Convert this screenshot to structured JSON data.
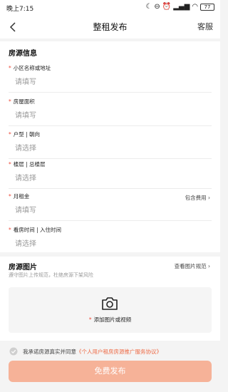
{
  "status": {
    "time": "晚上7:15",
    "battery": "77"
  },
  "header": {
    "title": "整租发布",
    "service_label": "客服"
  },
  "form": {
    "section_title": "房源信息",
    "fields": [
      {
        "label": "小区名称或地址",
        "placeholder": "请填写",
        "required": true,
        "extra": ""
      },
      {
        "label": "房屋面积",
        "placeholder": "请填写",
        "required": true,
        "extra": ""
      },
      {
        "label": "户型 | 朝向",
        "placeholder": "请选择",
        "required": true,
        "extra": ""
      },
      {
        "label": "楼层 | 总楼层",
        "placeholder": "请选择",
        "required": true,
        "extra": ""
      },
      {
        "label": "月租金",
        "placeholder": "请填写",
        "required": true,
        "extra": "包含费用 ›"
      },
      {
        "label": "看房时间 | 入住时间",
        "placeholder": "请选择",
        "required": true,
        "extra": ""
      }
    ]
  },
  "photos": {
    "title": "房源图片",
    "hint": "遵守图片上传规范，杜绝房源下架风险",
    "view_rules": "查看图片规范 ›",
    "add_label": "添加图片或视频",
    "required_mark": "*"
  },
  "agreement": {
    "prefix": "我承诺房源真实并同意",
    "link": "《个人用户租房房源推广服务协议》"
  },
  "submit": {
    "label": "免费发布"
  },
  "colors": {
    "accent": "#ee6a45",
    "required": "#ee4b3a",
    "button": "#f6b298",
    "background": "#f4f4f4"
  }
}
